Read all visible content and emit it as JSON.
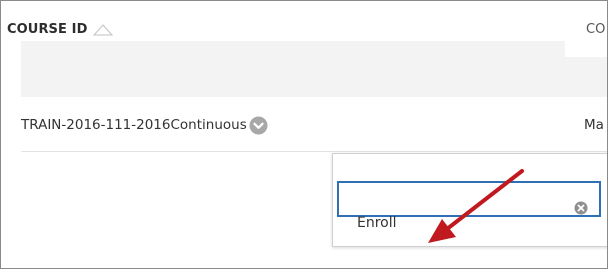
{
  "table": {
    "header": {
      "course_id_label": "COURSE ID",
      "col2_label_partial": "CO",
      "sort_icon": "sort-up-triangle-icon"
    },
    "row": {
      "course_id": "TRAIN-2016-111-2016Continuous",
      "col2_partial": "Ma",
      "options_icon": "chevron-down-icon"
    }
  },
  "context_menu": {
    "search_value": "",
    "clear_icon": "clear-circle-x-icon",
    "items": [
      {
        "label": "Enroll"
      }
    ]
  },
  "annotation": {
    "arrow_icon": "red-arrow-icon",
    "arrow_color": "#c0191f"
  },
  "colors": {
    "header_bg": "#f3f3f3",
    "focus_border": "#2f6fb5",
    "chevron_bg": "#a8a8a8",
    "text": "#333333"
  }
}
